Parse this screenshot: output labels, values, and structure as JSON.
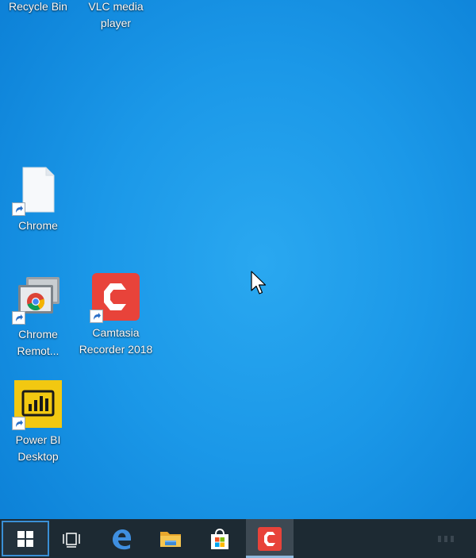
{
  "desktop": {
    "icons": [
      {
        "id": "recycle-bin",
        "label": "Recycle Bin"
      },
      {
        "id": "vlc",
        "label": "VLC media player"
      },
      {
        "id": "chrome",
        "label": "Chrome"
      },
      {
        "id": "chrome-remote",
        "label": "Chrome Remot..."
      },
      {
        "id": "camtasia",
        "label": "Camtasia Recorder 2018"
      },
      {
        "id": "power-bi",
        "label": "Power BI Desktop"
      }
    ]
  },
  "taskbar": {
    "buttons": [
      {
        "id": "start",
        "icon": "windows-logo-icon"
      },
      {
        "id": "task-view",
        "icon": "task-view-icon"
      },
      {
        "id": "edge",
        "icon": "edge-icon"
      },
      {
        "id": "file-explorer",
        "icon": "folder-icon"
      },
      {
        "id": "store",
        "icon": "store-bag-icon"
      },
      {
        "id": "camtasia",
        "icon": "camtasia-icon"
      }
    ]
  },
  "colors": {
    "desktop": "#1b98e8",
    "taskbar": "#1d2a33",
    "camtasia": "#e8433a",
    "power_bi": "#f2c811"
  }
}
